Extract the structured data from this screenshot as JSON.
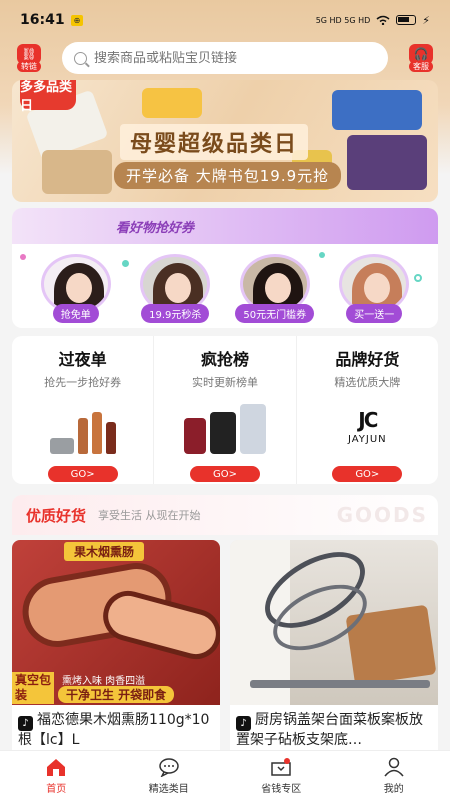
{
  "status": {
    "time": "16:41",
    "badge": "⊕",
    "network": "5G HD 5G HD",
    "wifi": "wifi"
  },
  "header": {
    "left_icon": "link-icon",
    "left_label": "转链",
    "search_placeholder": "搜索商品或粘贴宝贝链接",
    "right_icon": "headset-icon",
    "right_label": "客服"
  },
  "banner": {
    "logo": "多多品类日",
    "title": "母婴超级品类日",
    "subtitle": "开学必备 大牌书包19.9元抢"
  },
  "coupon": {
    "heading": "看好物抢好券",
    "items": [
      {
        "tag": "抢免单"
      },
      {
        "tag": "19.9元秒杀"
      },
      {
        "tag": "50元无门槛券"
      },
      {
        "tag": "买一送一"
      }
    ]
  },
  "categories": [
    {
      "title": "过夜单",
      "subtitle": "抢先一步抢好券",
      "button": "GO>"
    },
    {
      "title": "疯抢榜",
      "subtitle": "实时更新榜单",
      "button": "GO>"
    },
    {
      "title": "品牌好货",
      "subtitle": "精选优质大牌",
      "button": "GO>",
      "brand": "JAYJUN"
    }
  ],
  "section": {
    "title": "优质好货",
    "subtitle": "享受生活 从现在开始",
    "en": "GOODS"
  },
  "goods": [
    {
      "name": "福恋德果木烟熏肠110g*10根【lc】L",
      "img_banner": "果木烟熏肠",
      "img_tag1": "真空包装",
      "img_tag2": "熏烤入味 肉香四溢",
      "img_tag3": "干净卫生 开袋即食"
    },
    {
      "name": "厨房锅盖架台面菜板案板放置架子砧板支架底…"
    }
  ],
  "tabs": [
    {
      "label": "首页",
      "icon": "home-icon"
    },
    {
      "label": "精选类目",
      "icon": "chat-icon"
    },
    {
      "label": "省钱专区",
      "icon": "wallet-icon"
    },
    {
      "label": "我的",
      "icon": "user-icon"
    }
  ],
  "colors": {
    "accent": "#e8322b",
    "purple": "#a24cd6",
    "gold": "#b78550"
  }
}
